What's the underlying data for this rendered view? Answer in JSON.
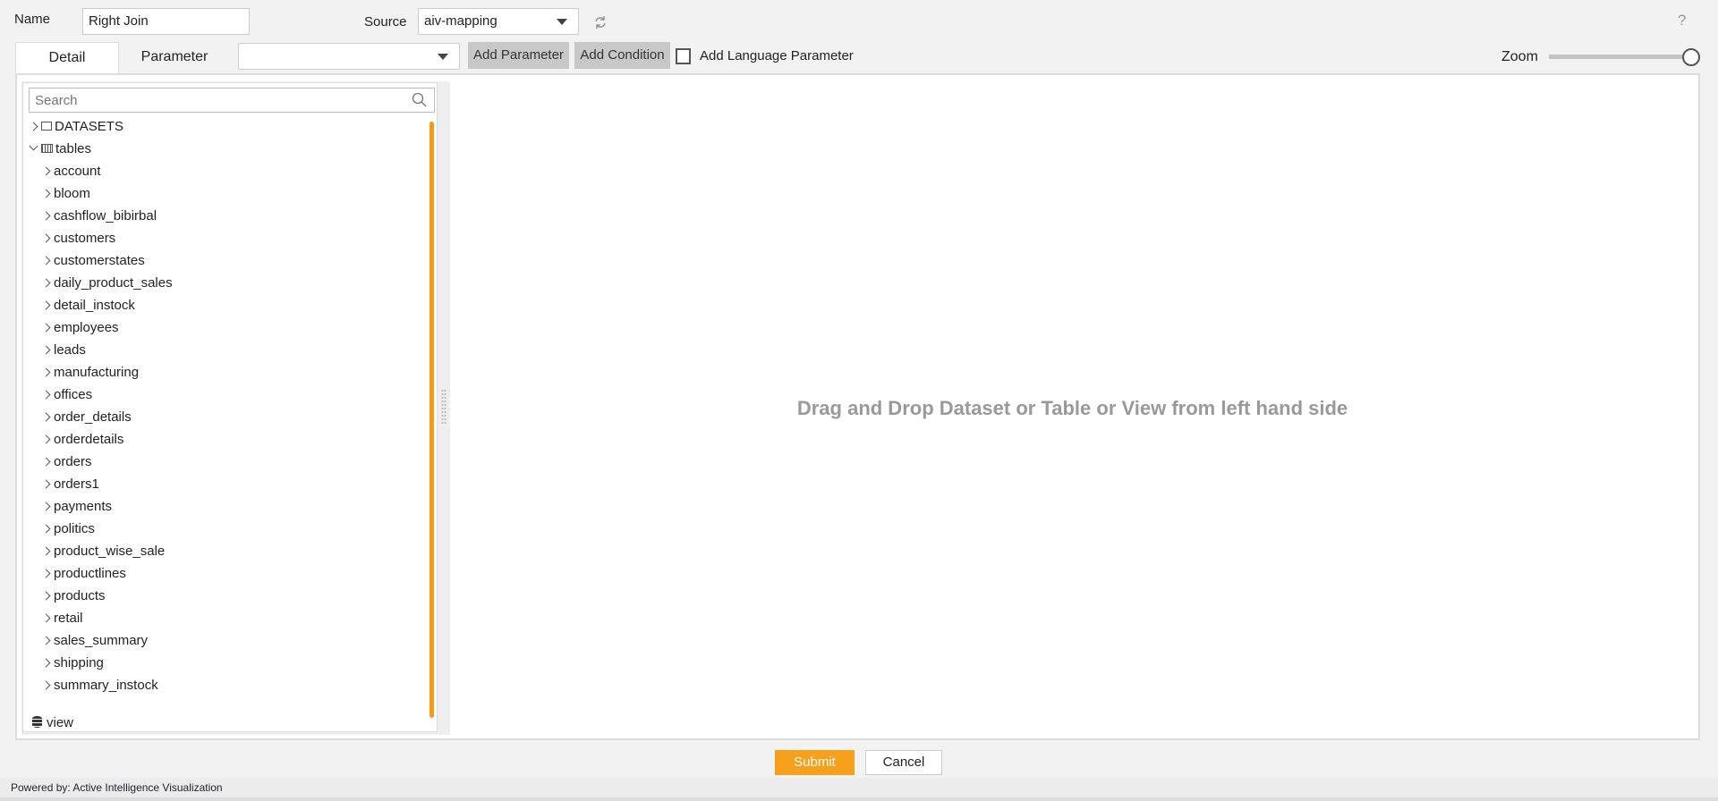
{
  "header": {
    "name_label": "Name",
    "name_value": "Right Join",
    "source_label": "Source",
    "source_value": "aiv-mapping",
    "help": "?"
  },
  "toolbar": {
    "tabs": [
      {
        "label": "Detail",
        "active": true
      },
      {
        "label": "Parameter",
        "active": false
      }
    ],
    "parameter_select_value": "",
    "add_parameter": "Add Parameter",
    "add_condition": "Add Condition",
    "add_language_parameter": "Add Language Parameter",
    "add_language_checked": false,
    "zoom_label": "Zoom",
    "zoom_level": 1.0
  },
  "tree": {
    "search_placeholder": "Search",
    "datasets": "DATASETS",
    "tables": "tables",
    "table_items": [
      "account",
      "bloom",
      "cashflow_bibirbal",
      "customers",
      "customerstates",
      "daily_product_sales",
      "detail_instock",
      "employees",
      "leads",
      "manufacturing",
      "offices",
      "order_details",
      "orderdetails",
      "orders",
      "orders1",
      "payments",
      "politics",
      "product_wise_sale",
      "productlines",
      "products",
      "retail",
      "sales_summary",
      "shipping",
      "summary_instock"
    ],
    "view": "view"
  },
  "canvas": {
    "hint": "Drag and Drop Dataset or Table or View from left hand side"
  },
  "actions": {
    "submit": "Submit",
    "cancel": "Cancel"
  },
  "footer": {
    "powered_by": "Powered by: Active Intelligence Visualization"
  },
  "colors": {
    "accent": "#f7a01b",
    "scrollbar": "#f39c12"
  }
}
